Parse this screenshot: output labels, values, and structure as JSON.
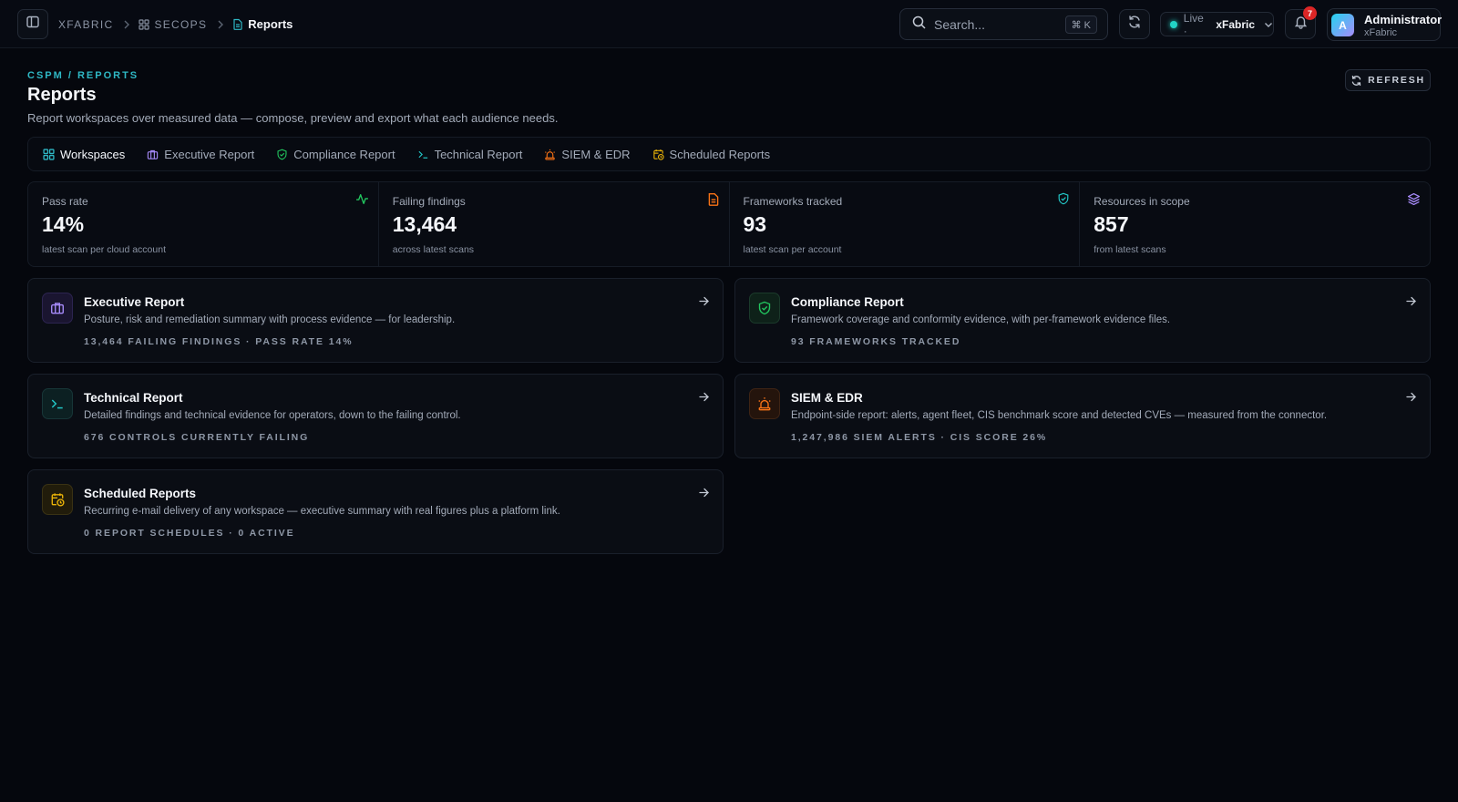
{
  "topbar": {
    "breadcrumbs": [
      "XFABRIC",
      "SECOPS",
      "Reports"
    ],
    "search_placeholder": "Search...",
    "search_shortcut": "⌘ K",
    "live_label": "Live ·",
    "live_org": "xFabric",
    "notification_count": "7",
    "user": {
      "initial": "A",
      "name": "Administrator",
      "org": "xFabric"
    }
  },
  "header": {
    "eyebrow": "CSPM / REPORTS",
    "title": "Reports",
    "subtitle": "Report workspaces over measured data — compose, preview and export what each audience needs.",
    "refresh_label": "REFRESH"
  },
  "tabs": [
    {
      "label": "Workspaces",
      "icon": "grid-icon",
      "active": true
    },
    {
      "label": "Executive Report",
      "icon": "briefcase-icon",
      "active": false
    },
    {
      "label": "Compliance Report",
      "icon": "shield-check-icon",
      "active": false
    },
    {
      "label": "Technical Report",
      "icon": "terminal-icon",
      "active": false
    },
    {
      "label": "SIEM & EDR",
      "icon": "siren-icon",
      "active": false
    },
    {
      "label": "Scheduled Reports",
      "icon": "calendar-clock-icon",
      "active": false
    }
  ],
  "stats": [
    {
      "label": "Pass rate",
      "value": "14%",
      "note": "latest scan per cloud account",
      "icon": "activity-icon",
      "color": "#22c55e"
    },
    {
      "label": "Failing findings",
      "value": "13,464",
      "note": "across latest scans",
      "icon": "file-text-icon",
      "color": "#f97316"
    },
    {
      "label": "Frameworks tracked",
      "value": "93",
      "note": "latest scan per account",
      "icon": "shield-check-icon",
      "color": "#22c5c5"
    },
    {
      "label": "Resources in scope",
      "value": "857",
      "note": "from latest scans",
      "icon": "layers-icon",
      "color": "#a78bfa"
    }
  ],
  "cards": [
    {
      "title": "Executive Report",
      "desc": "Posture, risk and remediation summary with process evidence — for leadership.",
      "meta": "13,464 FAILING FINDINGS · PASS RATE 14%",
      "icon": "briefcase-icon",
      "color": "#a78bfa"
    },
    {
      "title": "Compliance Report",
      "desc": "Framework coverage and conformity evidence, with per-framework evidence files.",
      "meta": "93 FRAMEWORKS TRACKED",
      "icon": "shield-check-icon",
      "color": "#22c55e"
    },
    {
      "title": "Technical Report",
      "desc": "Detailed findings and technical evidence for operators, down to the failing control.",
      "meta": "676 CONTROLS CURRENTLY FAILING",
      "icon": "terminal-icon",
      "color": "#22c5c5"
    },
    {
      "title": "SIEM & EDR",
      "desc": "Endpoint-side report: alerts, agent fleet, CIS benchmark score and detected CVEs — measured from the connector.",
      "meta": "1,247,986 SIEM ALERTS · CIS SCORE 26%",
      "icon": "siren-icon",
      "color": "#f97316"
    },
    {
      "title": "Scheduled Reports",
      "desc": "Recurring e-mail delivery of any workspace — executive summary with real figures plus a platform link.",
      "meta": "0 REPORT SCHEDULES · 0 ACTIVE",
      "icon": "calendar-clock-icon",
      "color": "#eab308"
    }
  ]
}
